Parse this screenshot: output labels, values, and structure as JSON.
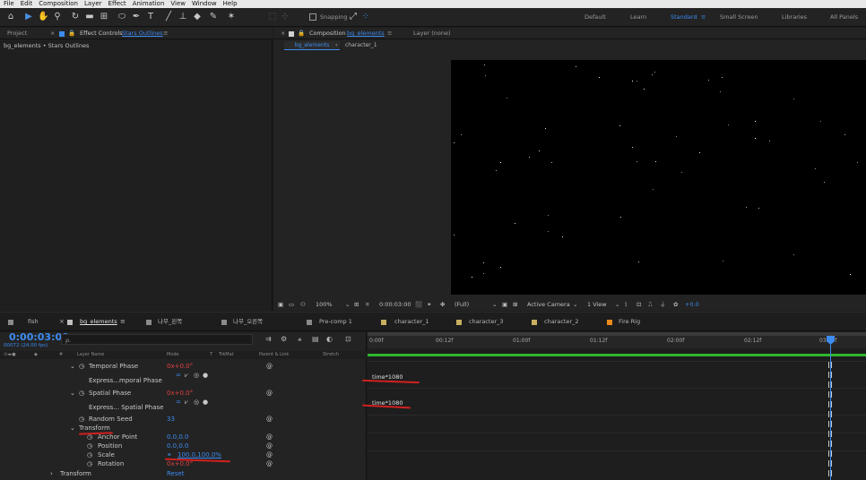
{
  "menu": [
    "File",
    "Edit",
    "Composition",
    "Layer",
    "Effect",
    "Animation",
    "View",
    "Window",
    "Help"
  ],
  "toolbar": {
    "snapping_label": "Snapping",
    "workspaces": [
      "Default",
      "Learn",
      "Standard",
      "Small Screen",
      "Libraries",
      "All Panels"
    ],
    "active_workspace": "Standard"
  },
  "left_panel": {
    "tab_project": "Project",
    "tab_effect_controls_prefix": "Effect Controls",
    "tab_effect_controls_layer": "Stars Outlines",
    "breadcrumb": "bg_elements • Stars Outlines"
  },
  "comp_panel": {
    "tab_prefix": "Composition",
    "tab_comp": "bg_elements",
    "layer_tab": "Layer (none)",
    "flow": [
      "bg_elements",
      "character_1"
    ],
    "zoom": "100%",
    "timecode": "0:00:03:00",
    "resolution": "(Full)",
    "camera": "Active Camera",
    "views": "1 View",
    "exposure": "+0.0"
  },
  "timeline_tabs": [
    {
      "label": "fish",
      "color": "#8a8a8a"
    },
    {
      "label": "bg_elements",
      "color": "#8a8a8a"
    },
    {
      "label": "나무_왼쪽",
      "color": "#8a8a8a"
    },
    {
      "label": "나무_오른쪽",
      "color": "#8a8a8a"
    },
    {
      "label": "Pre-comp 1",
      "color": "#8a8a8a"
    },
    {
      "label": "character_1",
      "color": "#c8b060"
    },
    {
      "label": "character_3",
      "color": "#c8b060"
    },
    {
      "label": "character_2",
      "color": "#c8b060"
    },
    {
      "label": "Fire Rig",
      "color": "#f08a1c"
    }
  ],
  "timeline": {
    "current_time": "0:00:03:00",
    "frame_info": "00072 (24.00 fps)",
    "search_placeholder": "ρ.",
    "columns": {
      "layer_name": "Layer Name",
      "mode": "Mode",
      "t": "T",
      "trkmat": "TrkMat",
      "parent": "Parent & Link",
      "stretch": "Stretch"
    },
    "ruler": [
      "0:00f",
      "00:12f",
      "01:00f",
      "01:12f",
      "02:00f",
      "02:12f",
      "03:00f"
    ],
    "rows": [
      {
        "label": "Temporal Phase",
        "value": "0x+0.0°",
        "value_color": "#e04040",
        "has_expr": false
      },
      {
        "label": "Express...mporal Phase",
        "value": "",
        "has_expr": true
      },
      {
        "label": "Spatial Phase",
        "value": "0x+0.0°",
        "value_color": "#e04040",
        "has_expr": false
      },
      {
        "label": "Express... Spatial Phase",
        "value": "",
        "has_expr": true
      },
      {
        "label": "Random Seed",
        "value": "33",
        "value_color": "#3d8cf0",
        "has_expr": false
      },
      {
        "label": "Transform",
        "value": "",
        "has_expr": false
      },
      {
        "label": "Anchor Point",
        "value": "0.0,0.0",
        "value_color": "#3d8cf0",
        "has_expr": false
      },
      {
        "label": "Position",
        "value": "0.0,0.0",
        "value_color": "#3d8cf0",
        "has_expr": false
      },
      {
        "label": "Scale",
        "value": "100.0,100.0%",
        "value_color": "#3d8cf0",
        "has_expr": false
      },
      {
        "label": "Rotation",
        "value": "0x+0.0°",
        "value_color": "#e04040",
        "has_expr": false
      },
      {
        "label": "Transform",
        "value": "Reset",
        "value_color": "#3d8cf0",
        "has_expr": false
      }
    ],
    "expressions": [
      "time*1080",
      "time*1080"
    ]
  }
}
